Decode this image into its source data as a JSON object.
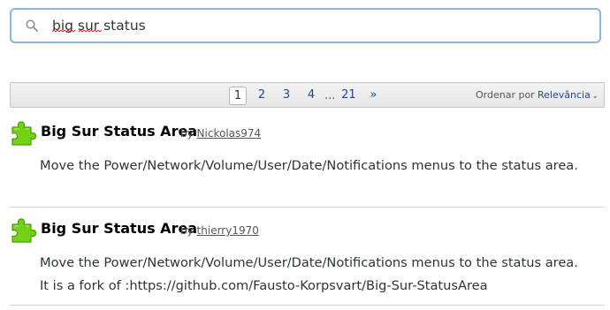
{
  "search": {
    "value": "big sur status",
    "placeholder": ""
  },
  "pagination": {
    "pages": [
      "1",
      "2",
      "3",
      "4"
    ],
    "current_page": "1",
    "ellipsis": "...",
    "last_page": "21",
    "next_label": "»"
  },
  "sort": {
    "label": "Ordenar por",
    "selected": "Relevância",
    "chevron": "⌄"
  },
  "results": [
    {
      "title": "Big Sur Status Area",
      "by_label": "by",
      "author": "Nickolas974",
      "description": "Move the Power/Network/Volume/User/Date/Notifications menus to the status area."
    },
    {
      "title": "Big Sur Status Area",
      "by_label": "by",
      "author": "thierry1970",
      "description": "Move the Power/Network/Volume/User/Date/Notifications menus to the status area. It is a fork of :https://github.com/Fausto-Korpsvart/Big-Sur-StatusArea"
    }
  ],
  "icons": {
    "search": "search-icon",
    "extension": "puzzle-piece-icon"
  },
  "colors": {
    "search_border": "#8bb6e0",
    "link": "#204a87",
    "puzzle_green": "#73d216",
    "puzzle_dark": "#4e9a06"
  }
}
